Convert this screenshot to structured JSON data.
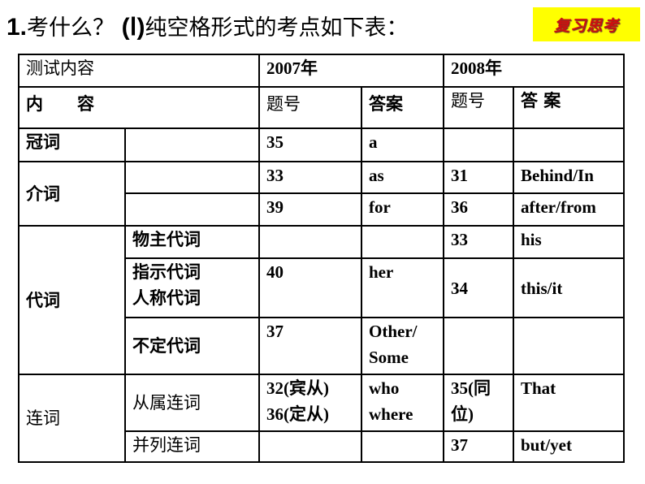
{
  "title": {
    "number": "1.",
    "text1": "考什么？",
    "paren": "(Ⅰ)",
    "text2": "纯空格形式的考点如下表："
  },
  "badge": {
    "label": "复习思考",
    "bg_color": "#ffff00",
    "text_color": "#cc1010"
  },
  "table": {
    "header": {
      "test_content": "测试内容",
      "year_2007": "2007年",
      "year_2008": "2008年",
      "content": "内　　容",
      "q_no_2007": "题号",
      "answer_2007": "答案",
      "q_no_2008": "题号",
      "answer_2008": "答 案"
    },
    "rows": {
      "article": {
        "category": "冠词",
        "q2007": "35",
        "a2007": "a",
        "q2008": "",
        "a2008": ""
      },
      "preposition": {
        "category": "介词",
        "r1": {
          "q2007": "33",
          "a2007": "as",
          "q2008": "31",
          "a2008": "Behind/In"
        },
        "r2": {
          "q2007": "39",
          "a2007": "for",
          "q2008": "36",
          "a2008": "after/from"
        }
      },
      "pronoun": {
        "category": "代词",
        "r1": {
          "sub": "物主代词",
          "q2007": "",
          "a2007": "",
          "q2008": "33",
          "a2008": "his"
        },
        "r2": {
          "sub1": "指示代词",
          "sub2": "人称代词",
          "q2007": "40",
          "a2007": "her",
          "q2008": "34",
          "a2008": "this/it"
        },
        "r3": {
          "sub": "不定代词",
          "q2007": "37",
          "a2007_l1": "Other/",
          "a2007_l2": "Some",
          "q2008": "",
          "a2008": ""
        }
      },
      "conjunction": {
        "category": "连词",
        "r1": {
          "sub": "从属连词",
          "q2007_l1": "32(宾从)",
          "q2007_l2": "36(定从)",
          "a2007_l1": "who",
          "a2007_l2": "where",
          "q2008_l1": "35(同",
          "q2008_l2": "位)",
          "a2008": "That"
        },
        "r2": {
          "sub": "并列连词",
          "q2007": "",
          "a2007": "",
          "q2008": "37",
          "a2008": "but/yet"
        }
      }
    }
  }
}
